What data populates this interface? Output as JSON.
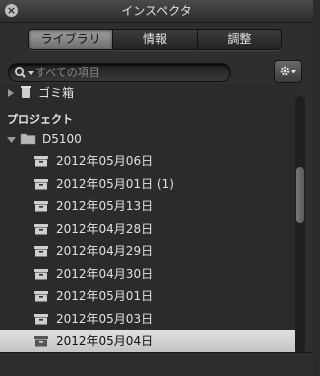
{
  "window": {
    "title": "インスペクタ",
    "close_glyph": "×"
  },
  "tabs": [
    {
      "label": "ライブラリ",
      "active": true
    },
    {
      "label": "情報",
      "active": false
    },
    {
      "label": "調整",
      "active": false
    }
  ],
  "search": {
    "placeholder": "すべての項目"
  },
  "library": {
    "partial_item_label": "ゴミ箱",
    "section_header": "プロジェクト",
    "project": {
      "label": "D5100",
      "icon": "folder-icon",
      "expanded": true
    },
    "items": [
      {
        "label": "2012年05月06日",
        "icon": "project-icon",
        "selected": false
      },
      {
        "label": "2012年05月01日 (1)",
        "icon": "project-icon",
        "selected": false
      },
      {
        "label": "2012年05月13日",
        "icon": "project-icon",
        "selected": false
      },
      {
        "label": "2012年04月28日",
        "icon": "project-icon",
        "selected": false
      },
      {
        "label": "2012年04月29日",
        "icon": "project-icon",
        "selected": false
      },
      {
        "label": "2012年04月30日",
        "icon": "project-icon",
        "selected": false
      },
      {
        "label": "2012年05月01日",
        "icon": "project-icon",
        "selected": false
      },
      {
        "label": "2012年05月03日",
        "icon": "project-icon",
        "selected": false
      },
      {
        "label": "2012年05月04日",
        "icon": "project-icon",
        "selected": true
      }
    ]
  },
  "colors": {
    "background": "#2e2e2e",
    "selection": "#d4d4d4",
    "text": "#e2e2e2"
  }
}
